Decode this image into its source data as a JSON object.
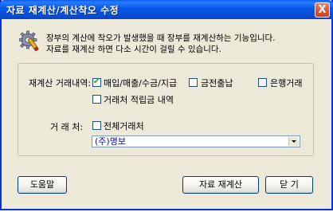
{
  "window": {
    "title": "자료 재계산/계산착오 수정",
    "close_glyph": "X"
  },
  "info": {
    "icon": "gear-icon",
    "line1": "장부의 계산에 착오가 발생했을 때 장부를 재계산하는 기능입니다.",
    "line2": "자료를 재계산 하면 다소 시간이 걸릴 수 있습니다."
  },
  "options": {
    "recalc_label": "재계산 거래내역:",
    "sales_purchase": {
      "label": "매입/매출/수금/지급",
      "checked": true
    },
    "cash": {
      "label": "금전출납",
      "checked": false
    },
    "bank": {
      "label": "은행거래",
      "checked": false
    },
    "client_accum": {
      "label": "거래처 적립금 내역",
      "checked": false
    },
    "client_label": "거 래 처:",
    "all_clients": {
      "label": "전체거래처",
      "checked": false
    },
    "client_selected": "(주)명보"
  },
  "buttons": {
    "help": "도움말",
    "recalc": "자료 재계산",
    "close": "닫 기"
  },
  "colors": {
    "titlebar": "#0a5ef7",
    "dialog_bg": "#ece9d8",
    "check_mark": "#21a121"
  }
}
